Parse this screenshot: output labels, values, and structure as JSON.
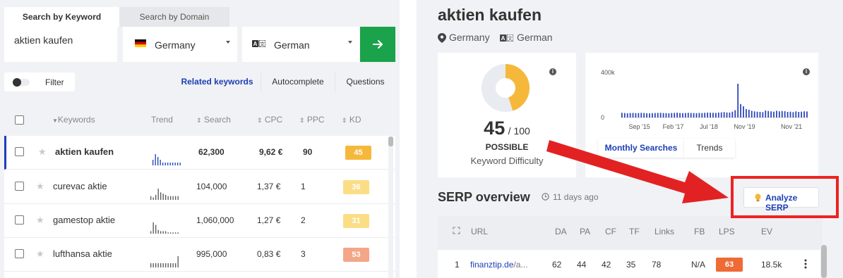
{
  "search_tabs": [
    "Search by Keyword",
    "Search by Domain"
  ],
  "search": {
    "keyword": "aktien kaufen",
    "country": "Germany",
    "language": "German",
    "go_icon": "arrow-right-icon"
  },
  "filter_label": "Filter",
  "keyword_tabs": [
    "Related keywords",
    "Autocomplete",
    "Questions"
  ],
  "table": {
    "headers": [
      "Keywords",
      "Trend",
      "Search",
      "CPC",
      "PPC",
      "KD"
    ],
    "rows": [
      {
        "keyword": "aktien kaufen",
        "search": "62,300",
        "cpc": "9,62 €",
        "ppc": "90",
        "kd": "45",
        "kd_color": "#f6b83b",
        "trend": [
          2,
          4,
          3,
          2,
          1,
          1,
          1,
          1,
          1,
          1,
          1,
          1
        ]
      },
      {
        "keyword": "curevac aktie",
        "search": "104,000",
        "cpc": "1,37 €",
        "ppc": "1",
        "kd": "36",
        "kd_color": "#fbdd86",
        "trend": [
          3,
          2,
          4,
          9,
          6,
          5,
          4,
          3,
          3,
          3,
          3,
          3
        ]
      },
      {
        "keyword": "gamestop aktie",
        "search": "1,060,000",
        "cpc": "1,27 €",
        "ppc": "2",
        "kd": "31",
        "kd_color": "#fbdd86",
        "trend": [
          2,
          9,
          7,
          3,
          2,
          2,
          2,
          1,
          1,
          1,
          1,
          1
        ]
      },
      {
        "keyword": "lufthansa aktie",
        "search": "995,000",
        "cpc": "0,83 €",
        "ppc": "3",
        "kd": "53",
        "kd_color": "#f4a688",
        "trend": [
          3,
          3,
          3,
          3,
          3,
          3,
          3,
          3,
          3,
          3,
          3,
          8
        ]
      }
    ]
  },
  "detail": {
    "title": "aktien kaufen",
    "country": "Germany",
    "language": "German",
    "kd_score": "45",
    "kd_max": "/ 100",
    "kd_label": "POSSIBLE",
    "kd_sub": "Keyword Difficulty",
    "kd_fraction": 0.45,
    "trend_tabs": [
      "Monthly Searches",
      "Trends"
    ]
  },
  "chart_data": {
    "type": "bar",
    "title": "",
    "ytick_labels": [
      "400k",
      "0"
    ],
    "xtick_labels": [
      "Sep '15",
      "Feb '17",
      "Jul '18",
      "Nov '19",
      "Nov '21"
    ],
    "ylim": [
      0,
      400000
    ],
    "values": [
      42000,
      40000,
      38000,
      40000,
      41000,
      39000,
      40000,
      42000,
      40000,
      38000,
      37000,
      39000,
      40000,
      41000,
      42000,
      40000,
      39000,
      38000,
      40000,
      41000,
      43000,
      40000,
      39000,
      40000,
      42000,
      41000,
      40000,
      39000,
      41000,
      40000,
      42000,
      44000,
      43000,
      42000,
      41000,
      44000,
      46000,
      48000,
      45000,
      44000,
      52000,
      65000,
      300000,
      120000,
      100000,
      75000,
      70000,
      60000,
      55000,
      52000,
      50000,
      48000,
      62000,
      58000,
      55000,
      52000,
      60000,
      55000,
      58000,
      56000,
      50000,
      52000,
      48000,
      55000,
      50000,
      52000,
      55000,
      54000
    ]
  },
  "serp": {
    "title": "SERP overview",
    "time": "11 days ago",
    "analyze_label": "Analyze SERP",
    "headers": [
      "URL",
      "DA",
      "PA",
      "CF",
      "TF",
      "Links",
      "FB",
      "LPS",
      "EV"
    ],
    "row": {
      "rank": "1",
      "url_domain": "finanztip.de",
      "url_tail": "/a...",
      "da": "62",
      "pa": "44",
      "cf": "42",
      "tf": "35",
      "links": "78",
      "fb": "N/A",
      "lps": "63",
      "ev": "18.5k"
    }
  },
  "colors": {
    "accent": "#1b3fb5",
    "go": "#1aa34a",
    "highlight": "#e22222",
    "lps": "#ee6b35"
  }
}
